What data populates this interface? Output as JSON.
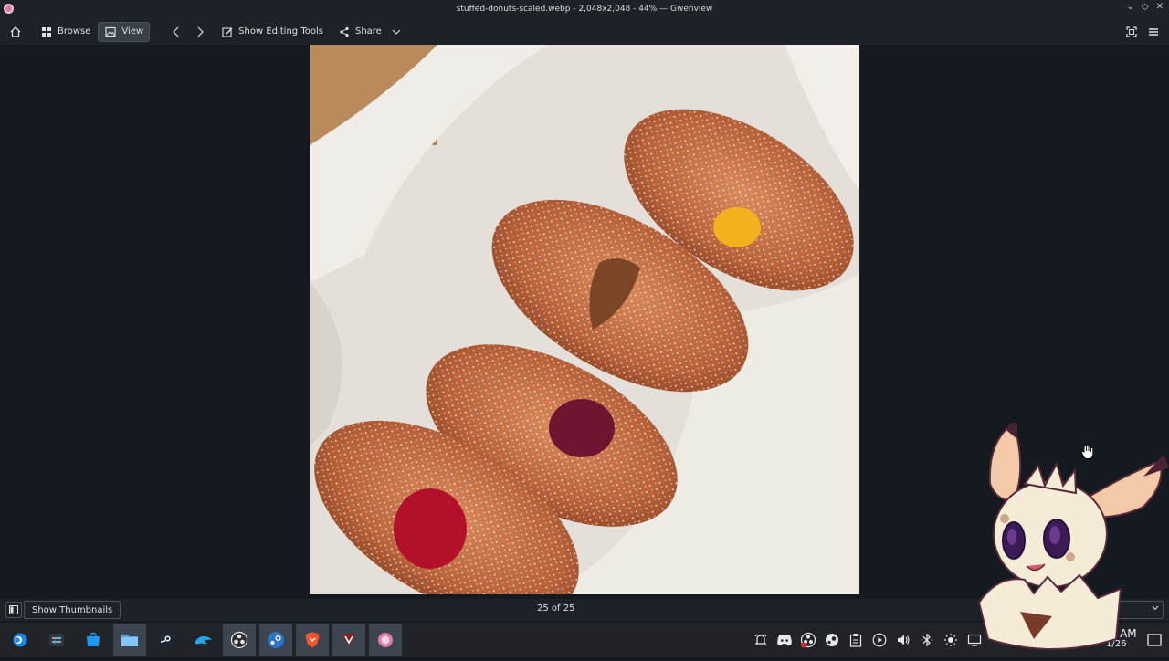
{
  "window": {
    "title": "stuffed-donuts-scaled.webp - 2,048x2,048 - 44% — Gwenview"
  },
  "toolbar": {
    "browse_label": "Browse",
    "view_label": "View",
    "edit_tools_label": "Show Editing Tools",
    "share_label": "Share"
  },
  "statusbar": {
    "thumbnails_label": "Show Thumbnails",
    "counter": "25 of 25"
  },
  "clock": {
    "time": "21 AM",
    "date": "1/26"
  },
  "colors": {
    "background": "#141a20",
    "toolbar": "#1d2228",
    "taskbar": "#202328"
  }
}
